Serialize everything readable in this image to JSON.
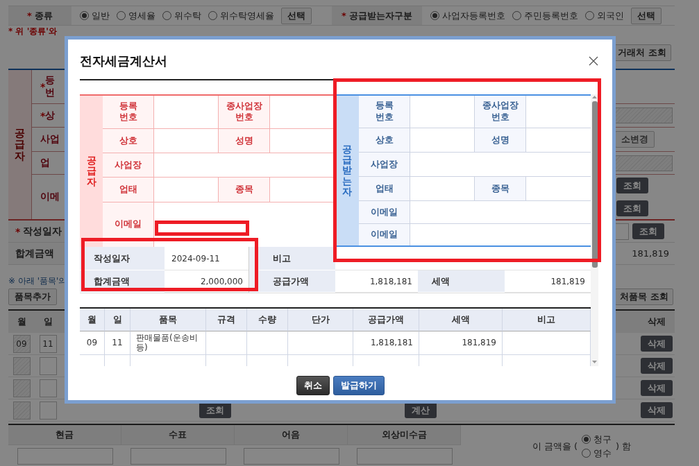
{
  "background": {
    "type_field": {
      "mark": "*",
      "label": "종류",
      "options": [
        {
          "label": "일반",
          "selected": true
        },
        {
          "label": "영세율",
          "selected": false
        },
        {
          "label": "위수탁",
          "selected": false
        },
        {
          "label": "위수탁영세율",
          "selected": false
        }
      ],
      "button": "선택"
    },
    "recipient_type_field": {
      "mark": "*",
      "label": "공급받는자구분",
      "options": [
        {
          "label": "사업자등록번호",
          "selected": true
        },
        {
          "label": "주민등록번호",
          "selected": false
        },
        {
          "label": "외국인",
          "selected": false
        }
      ],
      "button": "선택"
    },
    "notice": "* 위 '종류'와",
    "partner_lookup_button": "거래처 조회",
    "supplier": {
      "title": "공급자",
      "rows": [
        {
          "mark": "*",
          "label": "등\n번"
        },
        {
          "mark": "*",
          "label": "상",
          "control": {
            "kind": "hatched"
          }
        },
        {
          "label": "사업",
          "control": {
            "kind": "button",
            "text": "소변경"
          }
        },
        {
          "label": "업",
          "control": {
            "kind": "hatched"
          }
        },
        {
          "label": "이메",
          "control": {
            "kind": "buttons",
            "texts": [
              "조회",
              "조회"
            ]
          }
        }
      ]
    },
    "date_row": {
      "mark": "*",
      "label": "작성일자",
      "button": "조회"
    },
    "total_row": {
      "label": "합계금액",
      "amount": "181,819"
    },
    "items_note": "※ 아래 '품목'의",
    "add_item_button": "품목추가",
    "partner_items_button": "처품목 조회",
    "items_header": {
      "month": "월",
      "day": "일",
      "delete": "삭제"
    },
    "item_rows": [
      {
        "month": "09",
        "day": "11",
        "delete_button": "삭제"
      },
      {
        "delete_button": "삭제"
      },
      {
        "delete_button": "삭제"
      },
      {
        "delete_button": "삭제",
        "lookup_button": "조회",
        "calc_button": "계산"
      }
    ],
    "payment_columns": [
      "현금",
      "수표",
      "어음",
      "외상미수금"
    ],
    "claim": {
      "prefix": "이 금액을 (",
      "options": [
        {
          "label": "청구",
          "selected": true
        },
        {
          "label": "영수",
          "selected": false
        }
      ],
      "suffix": ") 함"
    }
  },
  "dialog": {
    "title": "전자세금계산서",
    "supplier": {
      "title": "공급자",
      "rows": [
        {
          "label": "등록\n번호",
          "label2": "종사업장\n번호"
        },
        {
          "label": "상호",
          "label2": "성명"
        },
        {
          "label": "사업장"
        },
        {
          "label": "업태",
          "label2": "종목"
        },
        {
          "label": "이메일",
          "kind": "email"
        }
      ]
    },
    "recipient": {
      "title": "공급받는자",
      "rows": [
        {
          "label": "등록\n번호",
          "label2": "종사업장\n번호"
        },
        {
          "label": "상호",
          "label2": "성명"
        },
        {
          "label": "사업장"
        },
        {
          "label": "업태",
          "label2": "종목"
        },
        {
          "label": "이메일"
        },
        {
          "label": "이메일"
        }
      ]
    },
    "summary": [
      {
        "label": "작성일자",
        "value": "2024-09-11"
      },
      {
        "label": "비고"
      },
      {
        "label": "합계금액",
        "value": "2,000,000"
      },
      {
        "label": "공급가액",
        "value": "1,818,181"
      },
      {
        "label": "세액",
        "value": "181,819"
      }
    ],
    "items": {
      "columns": [
        "월",
        "일",
        "품목",
        "규격",
        "수량",
        "단가",
        "공급가액",
        "세액",
        "비고"
      ],
      "rows": [
        {
          "month": "09",
          "day": "11",
          "item": "판매물품(운송비등)",
          "supply_amount": "1,818,181",
          "tax": "181,819"
        }
      ]
    },
    "buttons": [
      {
        "label": "취소",
        "kind": "secondary"
      },
      {
        "label": "발급하기",
        "kind": "primary"
      }
    ]
  }
}
